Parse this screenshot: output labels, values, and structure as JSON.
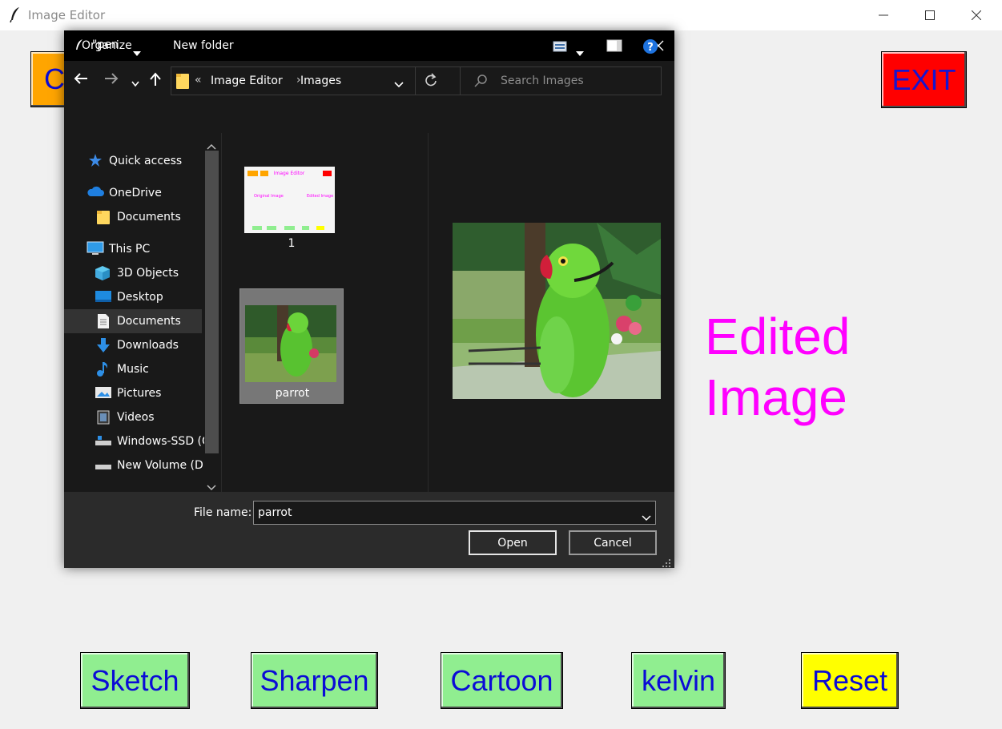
{
  "window": {
    "title": "Image Editor"
  },
  "main": {
    "open_button_label": "C",
    "exit_button_label": "EXIT",
    "edited_line1": "Edited",
    "edited_line2": "Image",
    "buttons": [
      "Sketch",
      "Sharpen",
      "Cartoon",
      "kelvin",
      "Reset"
    ]
  },
  "colors": {
    "open_button": "#ffa500",
    "exit_button": "#ff0000",
    "effect_buttons": "#90ee90",
    "reset_button": "#ffff00",
    "button_text": "#0b0bd6",
    "edited_label": "#ff00ff"
  },
  "dialog": {
    "title": "\"pen",
    "breadcrumb": [
      "Image Editor",
      "Images"
    ],
    "breadcrumb_prefix": "«",
    "breadcrumb_separator": "›",
    "search_placeholder": "Search Images",
    "toolbar": {
      "organize": "Organize",
      "new_folder": "New folder"
    },
    "nav": [
      {
        "label": "Quick access",
        "icon": "star-icon"
      },
      {
        "label": "OneDrive",
        "icon": "cloud-icon"
      },
      {
        "label": "Documents",
        "icon": "folder-icon"
      },
      {
        "label": "This PC",
        "icon": "monitor-icon"
      },
      {
        "label": "3D Objects",
        "icon": "cube-icon"
      },
      {
        "label": "Desktop",
        "icon": "desktop-icon"
      },
      {
        "label": "Documents",
        "icon": "document-icon"
      },
      {
        "label": "Downloads",
        "icon": "download-icon"
      },
      {
        "label": "Music",
        "icon": "music-note-icon"
      },
      {
        "label": "Pictures",
        "icon": "pictures-icon"
      },
      {
        "label": "Videos",
        "icon": "videos-icon"
      },
      {
        "label": "Windows-SSD (C",
        "icon": "drive-icon"
      },
      {
        "label": "New Volume (D:",
        "icon": "drive-icon"
      }
    ],
    "selected_nav": "Documents",
    "files": [
      {
        "name": "1",
        "thumb_text": [
          "Image Editor",
          "Original Image",
          "Edited Image"
        ]
      },
      {
        "name": "parrot"
      }
    ],
    "selected_file": "parrot",
    "file_name_label": "File name:",
    "file_name_value": "parrot",
    "open_label": "Open",
    "cancel_label": "Cancel"
  }
}
